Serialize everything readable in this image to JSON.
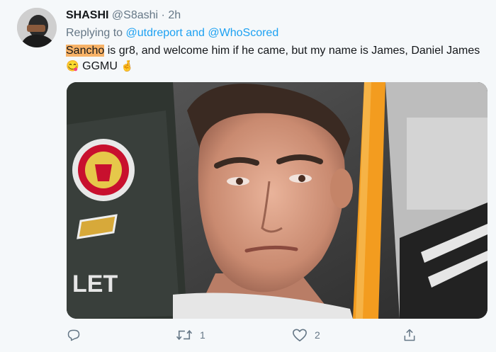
{
  "tweet": {
    "name": "SHASHI",
    "handle": "@S8ashi",
    "separator": "·",
    "time": "2h",
    "replying_prefix": "Replying to",
    "mention_1": "@utdreport",
    "and_text": "and",
    "mention_2": "@WhoScored",
    "text_highlight": "Sancho",
    "text_rest_1": " is gr8, and welcome him if he came, but my name is James, Daniel James",
    "emoji_1": "😋",
    "text_rest_2": " GGMU",
    "emoji_2": "🤞",
    "media_kit_text": "LET"
  },
  "actions": {
    "reply_icon": "reply-icon",
    "retweet_icon": "retweet-icon",
    "retweet_count": "1",
    "like_icon": "heart-icon",
    "like_count": "2",
    "share_icon": "share-icon"
  },
  "colors": {
    "background": "#f5f8fa",
    "link": "#1da1f2",
    "muted": "#657786",
    "highlight": "#f7b267"
  }
}
